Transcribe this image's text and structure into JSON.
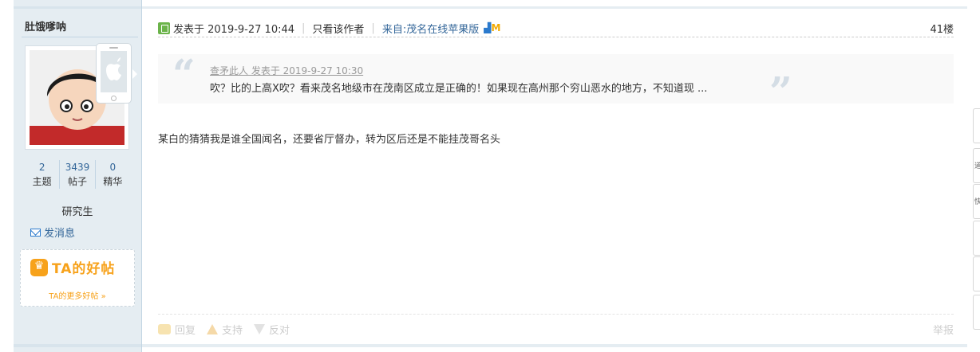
{
  "author": {
    "username": "肚饿嗲呐",
    "stats": [
      {
        "num": "2",
        "label": "主题"
      },
      {
        "num": "3439",
        "label": "帖子"
      },
      {
        "num": "0",
        "label": "精华"
      }
    ],
    "rank": "研究生",
    "send_message": "发消息",
    "good_posts_title": "TA的好帖",
    "good_posts_more": "TA的更多好帖 »"
  },
  "post": {
    "date": "发表于 2019-9-27 10:44",
    "only_author": "只看该作者",
    "from": "来自:茂名在线苹果版",
    "floor": "41楼",
    "quote": {
      "cite": "查矛此人 发表于 2019-9-27 10:30",
      "text": "吹？比的上高X吹？看来茂名地级市在茂南区成立是正确的！如果现在高州那个穷山恶水的地方，不知道现 ..."
    },
    "body": "某白的猜猜我是谁全国闻名，还要省厅督办，转为区后还是不能挂茂哥名头",
    "actions": {
      "reply": "回复",
      "support": "支持",
      "oppose": "反对",
      "report": "举报"
    }
  },
  "right_rail_tabs": [
    "",
    "道",
    "快",
    "",
    "",
    ""
  ]
}
